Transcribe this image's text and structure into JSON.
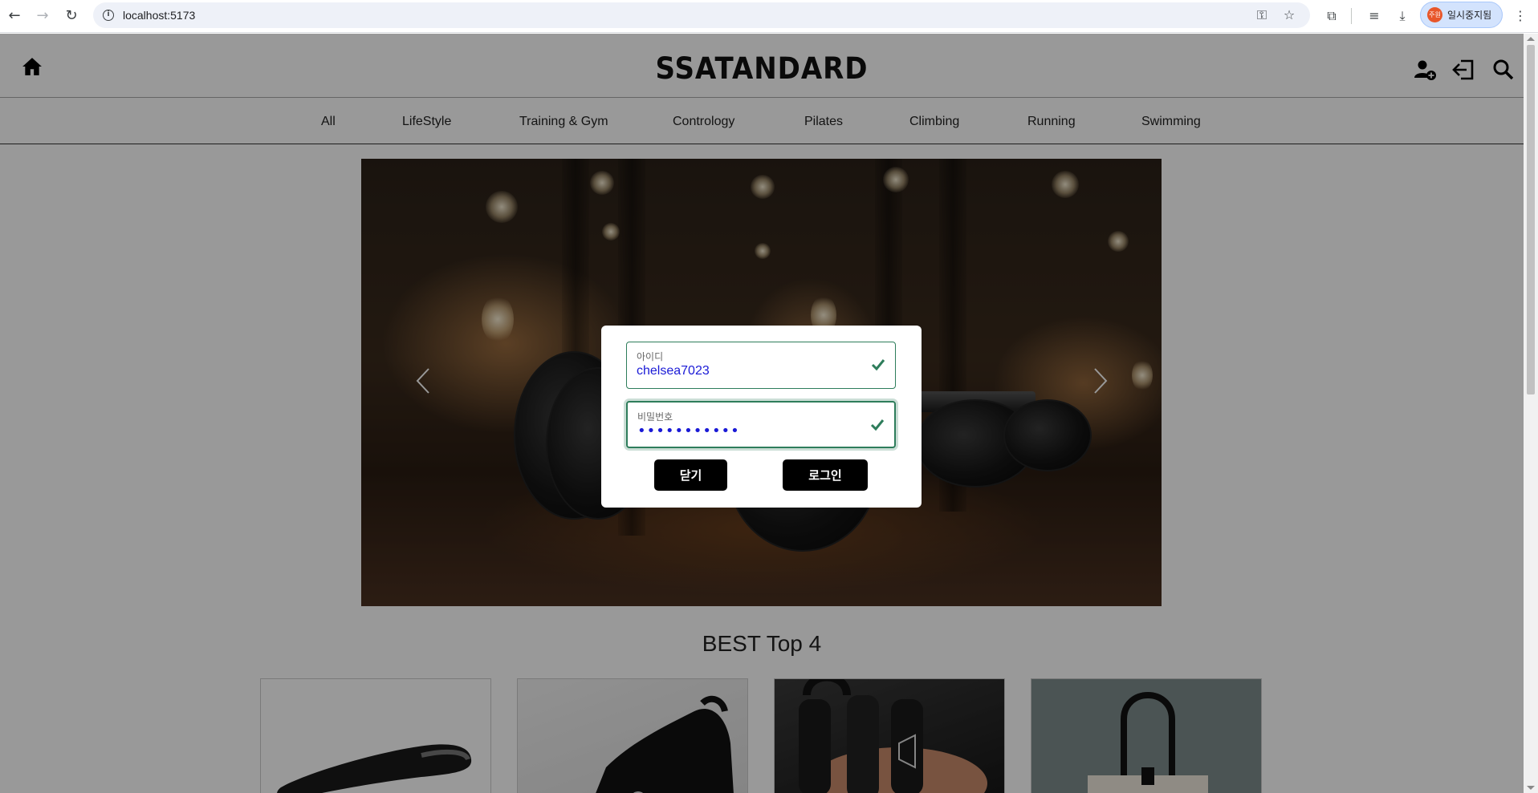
{
  "browser": {
    "url": "localhost:5173",
    "profile_badge": "주원",
    "profile_label": "일시중지됨"
  },
  "header": {
    "logo": "SSATANDARD"
  },
  "categories": [
    "All",
    "LifeStyle",
    "Training & Gym",
    "Contrology",
    "Pilates",
    "Climbing",
    "Running",
    "Swimming"
  ],
  "best_section": {
    "title": "BEST Top 4"
  },
  "login_modal": {
    "id_label": "아이디",
    "id_value": "chelsea7023",
    "pw_label": "비밀번호",
    "pw_value": "•••••••••••",
    "close_label": "닫기",
    "login_label": "로그인"
  },
  "colors": {
    "valid_border": "#2e7d5b",
    "input_text": "#1a1ad6",
    "button_bg": "#000000"
  }
}
